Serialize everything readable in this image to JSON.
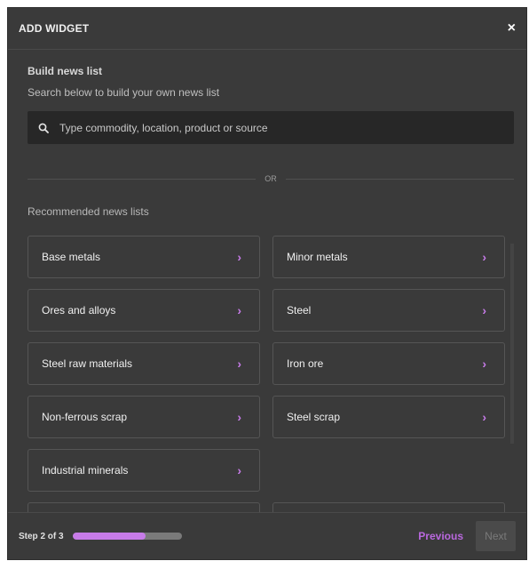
{
  "header": {
    "title": "ADD WIDGET",
    "close_label": "×"
  },
  "build": {
    "title": "Build news list",
    "subtitle": "Search below to build your own news list"
  },
  "search": {
    "placeholder": "Type commodity, location, product or source",
    "value": ""
  },
  "divider": {
    "text": "OR"
  },
  "recommended": {
    "title": "Recommended news lists",
    "items": [
      {
        "label": "Base metals"
      },
      {
        "label": "Minor metals"
      },
      {
        "label": "Ores and alloys"
      },
      {
        "label": "Steel"
      },
      {
        "label": "Steel raw materials"
      },
      {
        "label": "Iron ore"
      },
      {
        "label": "Non-ferrous scrap"
      },
      {
        "label": "Steel scrap"
      },
      {
        "label": "Industrial minerals"
      }
    ],
    "chevron": "›"
  },
  "footer": {
    "step_label": "Step 2 of 3",
    "progress": 0.67,
    "previous_label": "Previous",
    "next_label": "Next"
  },
  "colors": {
    "accent": "#c77be8",
    "background": "#3a3a3a",
    "input_bg": "#272727"
  }
}
